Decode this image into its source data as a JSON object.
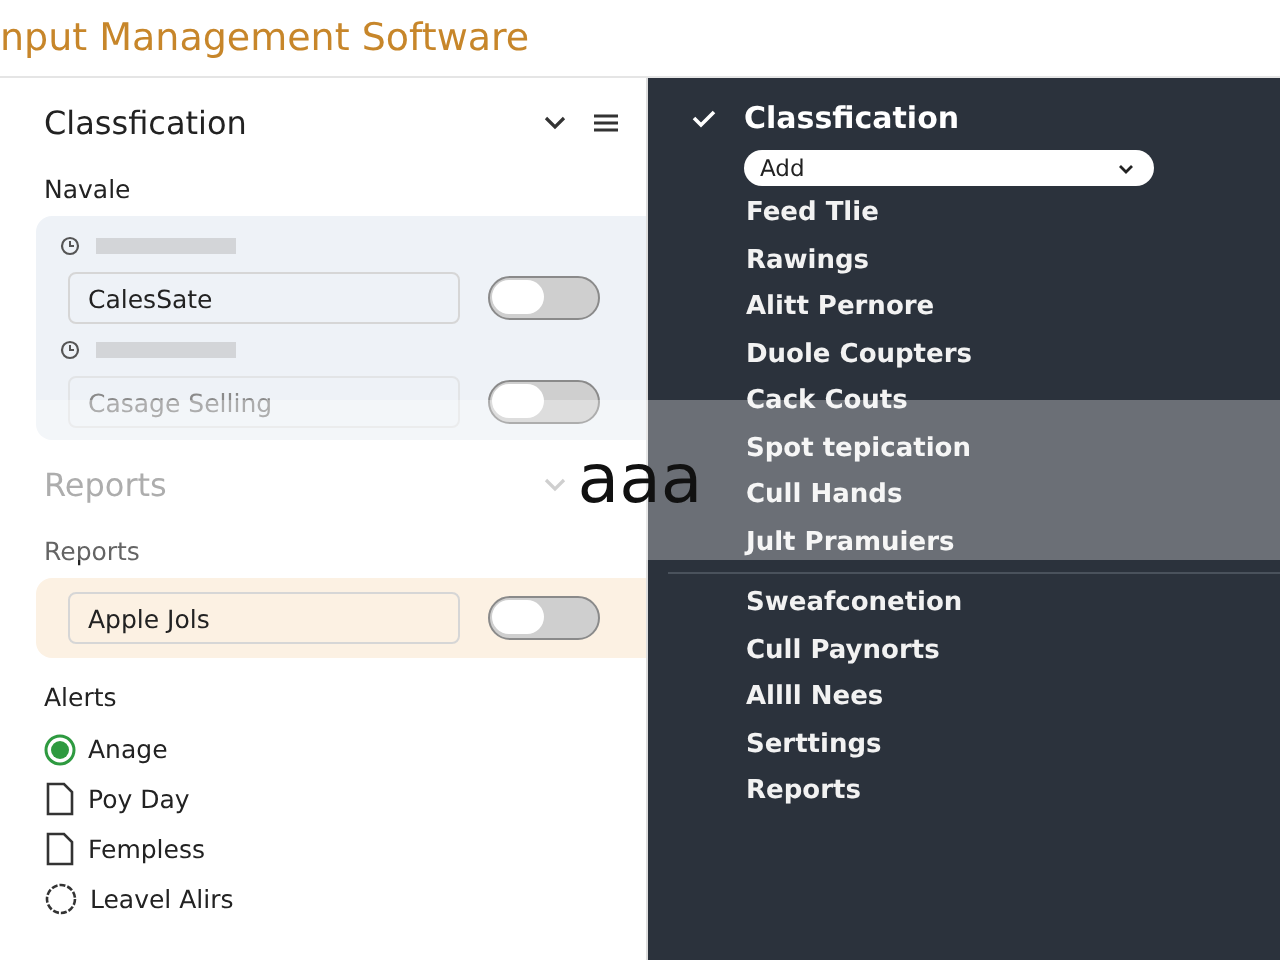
{
  "window": {
    "title": "nput Management Software"
  },
  "left_panel": {
    "title": "Classfication",
    "section_label": "Navale",
    "group": [
      {
        "field": {
          "value": "CalesSate"
        },
        "toggle": {
          "on": false
        }
      },
      {
        "field": {
          "placeholder": "Casage Selling"
        },
        "toggle": {
          "on": false
        }
      }
    ],
    "reports_header": {
      "title": "Reports",
      "disabled": true
    },
    "reports_label": "Reports",
    "reports_group": [
      {
        "field": {
          "value": "Apple Jols"
        },
        "toggle": {
          "on": false
        }
      }
    ],
    "alerts_label": "Alerts",
    "alerts": [
      {
        "label": "Anage",
        "kind": "radio",
        "selected": true
      },
      {
        "label": "Poy Day",
        "kind": "file",
        "selected": false
      },
      {
        "label": "Fempless",
        "kind": "file",
        "selected": false
      },
      {
        "label": "Leavel Alirs",
        "kind": "badge",
        "selected": false
      }
    ]
  },
  "right_panel": {
    "title": "Classfication",
    "dropdown": {
      "value": "Add"
    },
    "items": [
      "Feed Tlie",
      "Rawings",
      "Alitt Pernore",
      "Duole Coupters",
      "Cack Couts",
      "Spot tepication",
      "Cull Hands",
      "Jult Pramuiers"
    ],
    "items_2": [
      "Sweafconetion",
      "Cull Paynorts",
      "Allll Nees",
      "Serttings",
      "Reports"
    ]
  },
  "overlay": {
    "text": "aaa"
  }
}
